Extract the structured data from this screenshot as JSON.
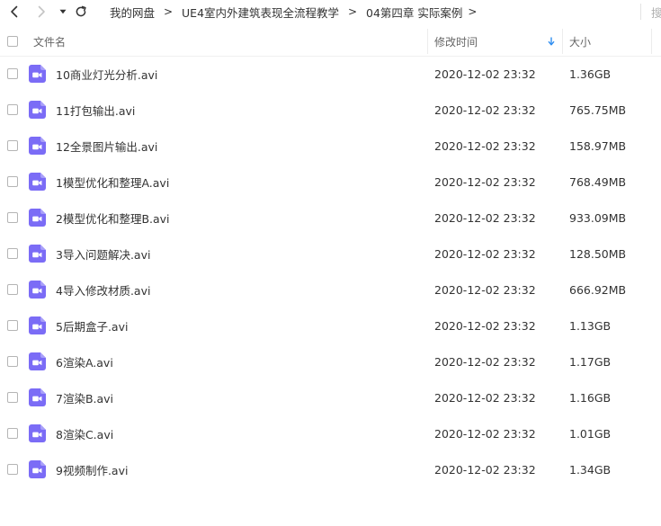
{
  "toolbar": {
    "breadcrumb": {
      "root": "我的网盘",
      "course": "UE4室内外建筑表现全流程教学",
      "chapter": "04第四章 实际案例"
    },
    "separator": ">",
    "search_stub": "搜"
  },
  "table": {
    "headers": {
      "name": "文件名",
      "modified": "修改时间",
      "size": "大小"
    },
    "sort_icon": "sort-down-arrow-icon",
    "file_icon": "video-file-icon",
    "accent_color": "#2f8ef0",
    "icon_color": "#7b6cf6",
    "rows": [
      {
        "name": "10商业灯光分析.avi",
        "modified": "2020-12-02 23:32",
        "size": "1.36GB"
      },
      {
        "name": "11打包输出.avi",
        "modified": "2020-12-02 23:32",
        "size": "765.75MB"
      },
      {
        "name": "12全景图片输出.avi",
        "modified": "2020-12-02 23:32",
        "size": "158.97MB"
      },
      {
        "name": "1模型优化和整理A.avi",
        "modified": "2020-12-02 23:32",
        "size": "768.49MB"
      },
      {
        "name": "2模型优化和整理B.avi",
        "modified": "2020-12-02 23:32",
        "size": "933.09MB"
      },
      {
        "name": "3导入问题解决.avi",
        "modified": "2020-12-02 23:32",
        "size": "128.50MB"
      },
      {
        "name": "4导入修改材质.avi",
        "modified": "2020-12-02 23:32",
        "size": "666.92MB"
      },
      {
        "name": "5后期盒子.avi",
        "modified": "2020-12-02 23:32",
        "size": "1.13GB"
      },
      {
        "name": "6渲染A.avi",
        "modified": "2020-12-02 23:32",
        "size": "1.17GB"
      },
      {
        "name": "7渲染B.avi",
        "modified": "2020-12-02 23:32",
        "size": "1.16GB"
      },
      {
        "name": "8渲染C.avi",
        "modified": "2020-12-02 23:32",
        "size": "1.01GB"
      },
      {
        "name": "9视频制作.avi",
        "modified": "2020-12-02 23:32",
        "size": "1.34GB"
      }
    ]
  }
}
